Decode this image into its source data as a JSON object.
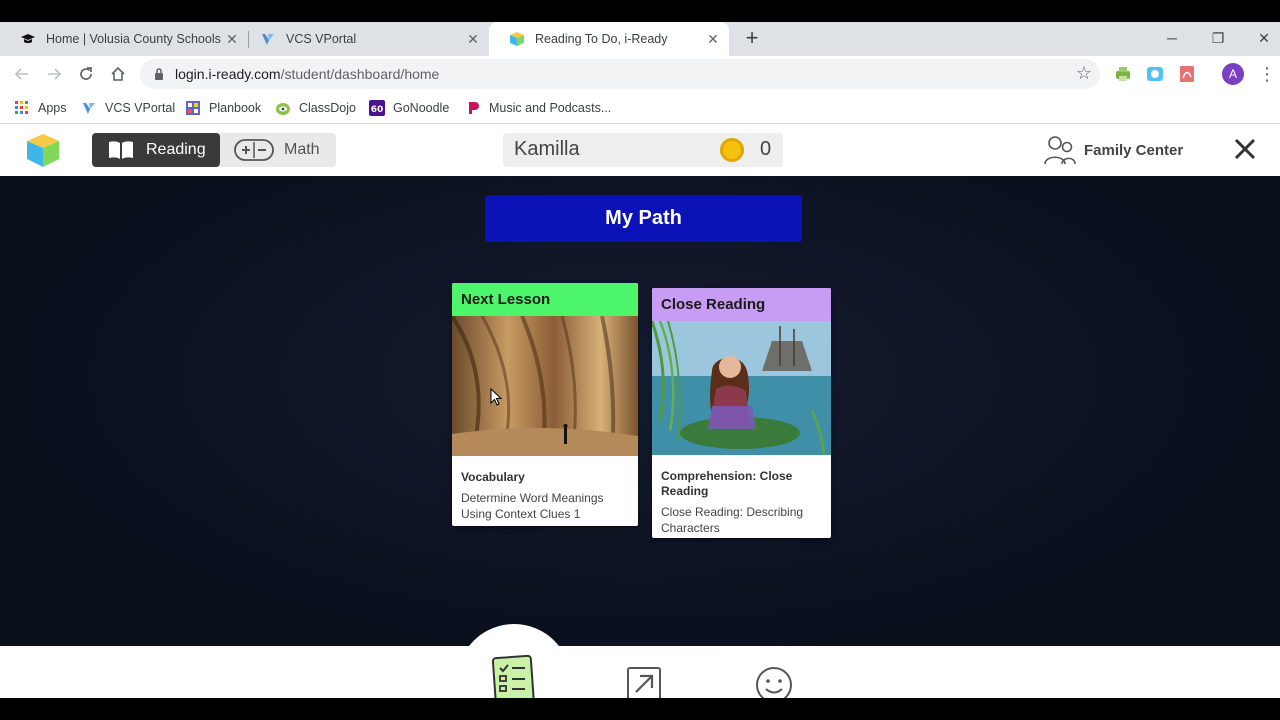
{
  "browser": {
    "tabs": [
      {
        "title": "Home | Volusia County Schools",
        "favicon": "graduation-cap-icon",
        "active": false
      },
      {
        "title": "VCS VPortal",
        "favicon": "vportal-icon",
        "active": false
      },
      {
        "title": "Reading To Do, i-Ready",
        "favicon": "iready-cube-icon",
        "active": true
      }
    ],
    "url_host": "login.i-ready.com",
    "url_path": "/student/dashboard/home",
    "profile_initial": "A",
    "bookmarks": [
      {
        "label": "Apps",
        "icon": "apps-grid-icon"
      },
      {
        "label": "VCS VPortal",
        "icon": "vportal-icon"
      },
      {
        "label": "Planbook",
        "icon": "planbook-icon"
      },
      {
        "label": "ClassDojo",
        "icon": "classdojo-icon"
      },
      {
        "label": "GoNoodle",
        "icon": "gonoodle-icon"
      },
      {
        "label": "Music and Podcasts...",
        "icon": "pandora-icon"
      }
    ]
  },
  "app": {
    "subjects": {
      "reading": "Reading",
      "math": "Math"
    },
    "student_name": "Kamilla",
    "coins": "0",
    "family_center": "Family Center",
    "my_path": "My Path",
    "cards": [
      {
        "header": "Next Lesson",
        "header_color": "#4df56a",
        "type": "Vocabulary",
        "description": "Determine Word Meanings Using Context Clues 1"
      },
      {
        "header": "Close Reading",
        "header_color": "#c79cf5",
        "type": "Comprehension: Close Reading",
        "description": "Close Reading: Describing Characters"
      }
    ],
    "bottom_nav": [
      "checklist-icon",
      "external-link-icon",
      "smiley-icon"
    ]
  }
}
